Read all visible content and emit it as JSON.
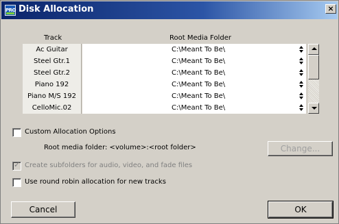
{
  "window": {
    "title": "Disk Allocation",
    "logo_text": "PRO",
    "close_label": "×"
  },
  "table": {
    "headers": [
      "Track",
      "Root Media Folder"
    ],
    "rows": [
      {
        "track": "Ac Guitar",
        "folder": "C:\\Meant To Be\\"
      },
      {
        "track": "Steel Gtr.1",
        "folder": "C:\\Meant To Be\\"
      },
      {
        "track": "Steel Gtr.2",
        "folder": "C:\\Meant To Be\\"
      },
      {
        "track": "Piano 192",
        "folder": "C:\\Meant To Be\\"
      },
      {
        "track": "Piano M/S 192",
        "folder": "C:\\Meant To Be\\"
      },
      {
        "track": "CelloMic.02",
        "folder": "C:\\Meant To Be\\"
      }
    ]
  },
  "options": {
    "custom_allocation_label": "Custom Allocation Options",
    "custom_allocation_checked": false,
    "root_media_folder_text": "Root media folder:  <volume>:<root folder>",
    "change_button_label": "Change...",
    "create_subfolders_label": "Create subfolders for audio, video, and fade files",
    "create_subfolders_checked": true,
    "round_robin_label": "Use round robin allocation for new tracks",
    "round_robin_checked": false
  },
  "buttons": {
    "cancel_label": "Cancel",
    "ok_label": "OK"
  },
  "colors": {
    "dialog_bg": "#d4d0c8",
    "titlebar_start": "#0a246a",
    "titlebar_end": "#a6caf0"
  }
}
